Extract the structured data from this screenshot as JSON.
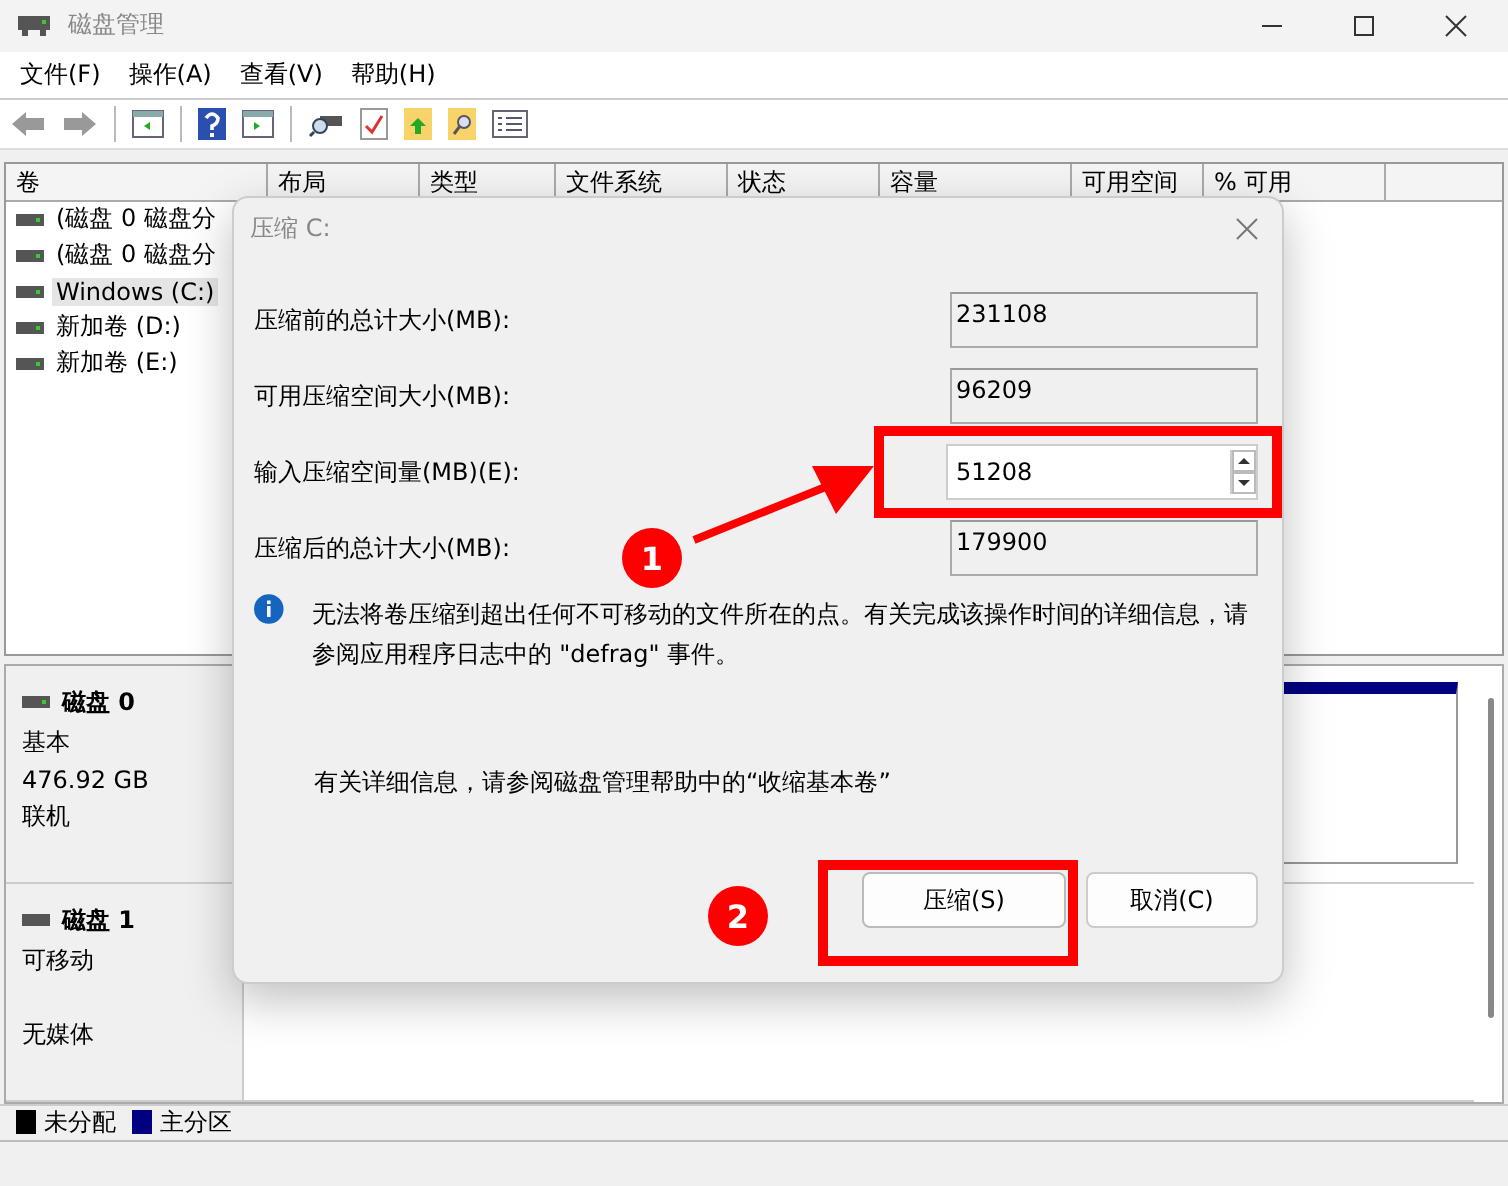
{
  "window": {
    "title": "磁盘管理"
  },
  "menu": [
    "文件(F)",
    "操作(A)",
    "查看(V)",
    "帮助(H)"
  ],
  "table": {
    "columns": [
      "卷",
      "布局",
      "类型",
      "文件系统",
      "状态",
      "容量",
      "可用空间",
      "% 可用"
    ],
    "rows": [
      {
        "volume": "(磁盘 0 磁盘分",
        "selected": false
      },
      {
        "volume": "(磁盘 0 磁盘分",
        "selected": false
      },
      {
        "volume": "Windows (C:)",
        "selected": true
      },
      {
        "volume": "新加卷 (D:)",
        "selected": false
      },
      {
        "volume": "新加卷 (E:)",
        "selected": false
      }
    ]
  },
  "disks": [
    {
      "name": "磁盘 0",
      "type": "基本",
      "size": "476.92 GB",
      "status": "联机"
    },
    {
      "name": "磁盘 1",
      "type": "可移动",
      "status": "无媒体"
    }
  ],
  "legend": [
    {
      "label": "未分配",
      "color": "#000000"
    },
    {
      "label": "主分区",
      "color": "#000080"
    }
  ],
  "dialog": {
    "title": "压缩 C:",
    "fields": [
      {
        "label": "压缩前的总计大小(MB):",
        "value": "231108",
        "kind": "readonly"
      },
      {
        "label": "可用压缩空间大小(MB):",
        "value": "96209",
        "kind": "readonly"
      },
      {
        "label": "输入压缩空间量(MB)(E):",
        "value": "51208",
        "kind": "spin"
      },
      {
        "label": "压缩后的总计大小(MB):",
        "value": "179900",
        "kind": "readonly"
      }
    ],
    "info": "无法将卷压缩到超出任何不可移动的文件所在的点。有关完成该操作时间的详细信息，请参阅应用程序日志中的 \"defrag\" 事件。",
    "help_text": "有关详细信息，请参阅磁盘管理帮助中的“收缩基本卷”",
    "buttons": [
      {
        "label": "压缩(S)"
      },
      {
        "label": "取消(C)"
      }
    ]
  },
  "annotations": [
    {
      "number": "1"
    },
    {
      "number": "2"
    }
  ]
}
